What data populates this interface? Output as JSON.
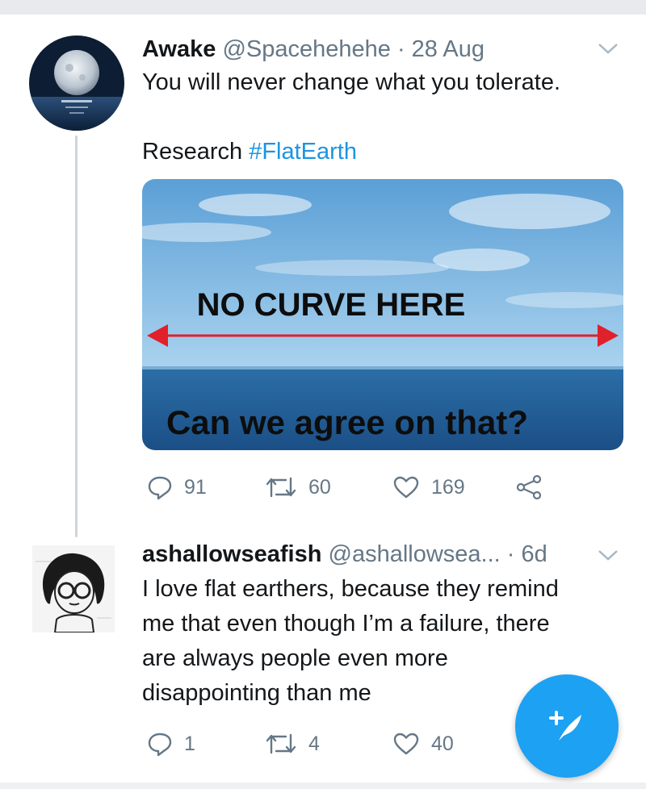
{
  "tweet1": {
    "name": "Awake",
    "handle": "@Spacehehehe",
    "dot": "·",
    "time": "28 Aug",
    "line1": "You will never change what you tolerate.",
    "research": "Research",
    "hashtag": "#FlatEarth",
    "media_text_top": "NO CURVE HERE",
    "media_text_bottom": "Can we agree on that?",
    "replies": "91",
    "retweets": "60",
    "likes": "169"
  },
  "tweet2": {
    "name": "ashallowseafish",
    "handle": "@ashallowsea...",
    "dot": "·",
    "time": "6d",
    "lines": [
      "I love flat earthers, because they remind",
      "me that even though I’m a failure, there",
      "are always people even more",
      "disappointing than me"
    ],
    "replies": "1",
    "retweets": "4",
    "likes": "40"
  },
  "colors": {
    "accent": "#1da1f2",
    "hashtag": "#1b95e0",
    "muted": "#657786",
    "arrow": "#e0202a"
  },
  "icons": [
    "chevron-down-icon",
    "reply-icon",
    "retweet-icon",
    "like-icon",
    "share-icon",
    "compose-icon"
  ]
}
